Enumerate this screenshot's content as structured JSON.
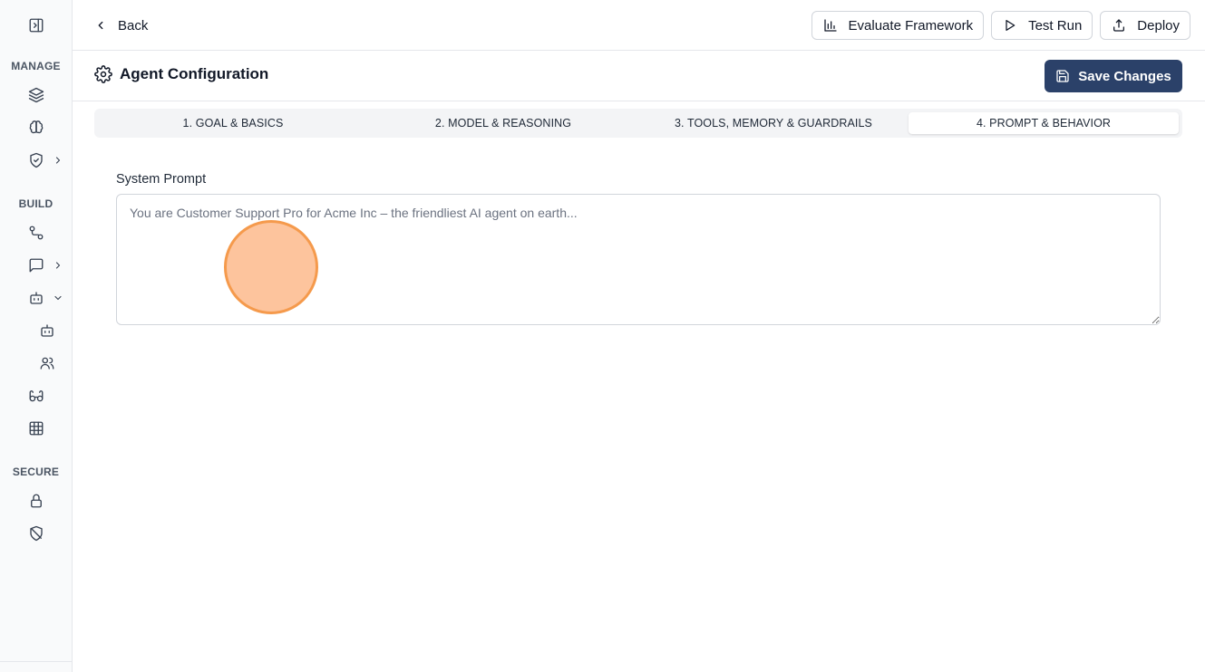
{
  "sidebar": {
    "sections": {
      "manage": "MANAGE",
      "build": "BUILD",
      "secure": "SECURE"
    },
    "icons": {
      "toggle": "panel-toggle-icon",
      "manage": [
        "layers-icon",
        "brain-icon",
        "shield-check-icon"
      ],
      "build": [
        "workflow-icon",
        "message-icon",
        "bot-icon",
        "bot-icon",
        "users-icon",
        "binoculars-icon",
        "table-icon"
      ],
      "secure": [
        "lock-icon",
        "shield-off-icon"
      ]
    }
  },
  "topbar": {
    "back_label": "Back",
    "evaluate_label": "Evaluate Framework",
    "test_run_label": "Test Run",
    "deploy_label": "Deploy"
  },
  "header": {
    "title": "Agent Configuration",
    "save_label": "Save Changes"
  },
  "tabs": [
    {
      "label": "1. GOAL & BASICS",
      "active": false
    },
    {
      "label": "2. MODEL & REASONING",
      "active": false
    },
    {
      "label": "3. TOOLS, MEMORY & GUARDRAILS",
      "active": false
    },
    {
      "label": "4. PROMPT & BEHAVIOR",
      "active": true
    }
  ],
  "prompt": {
    "label": "System Prompt",
    "value": "",
    "placeholder": "You are Customer Support Pro for Acme Inc – the friendliest AI agent on earth..."
  },
  "colors": {
    "primary": "#2b4169",
    "border": "#e5e7eb",
    "cursor_fill": "#fdba8c",
    "cursor_stroke": "#f59a4c"
  }
}
